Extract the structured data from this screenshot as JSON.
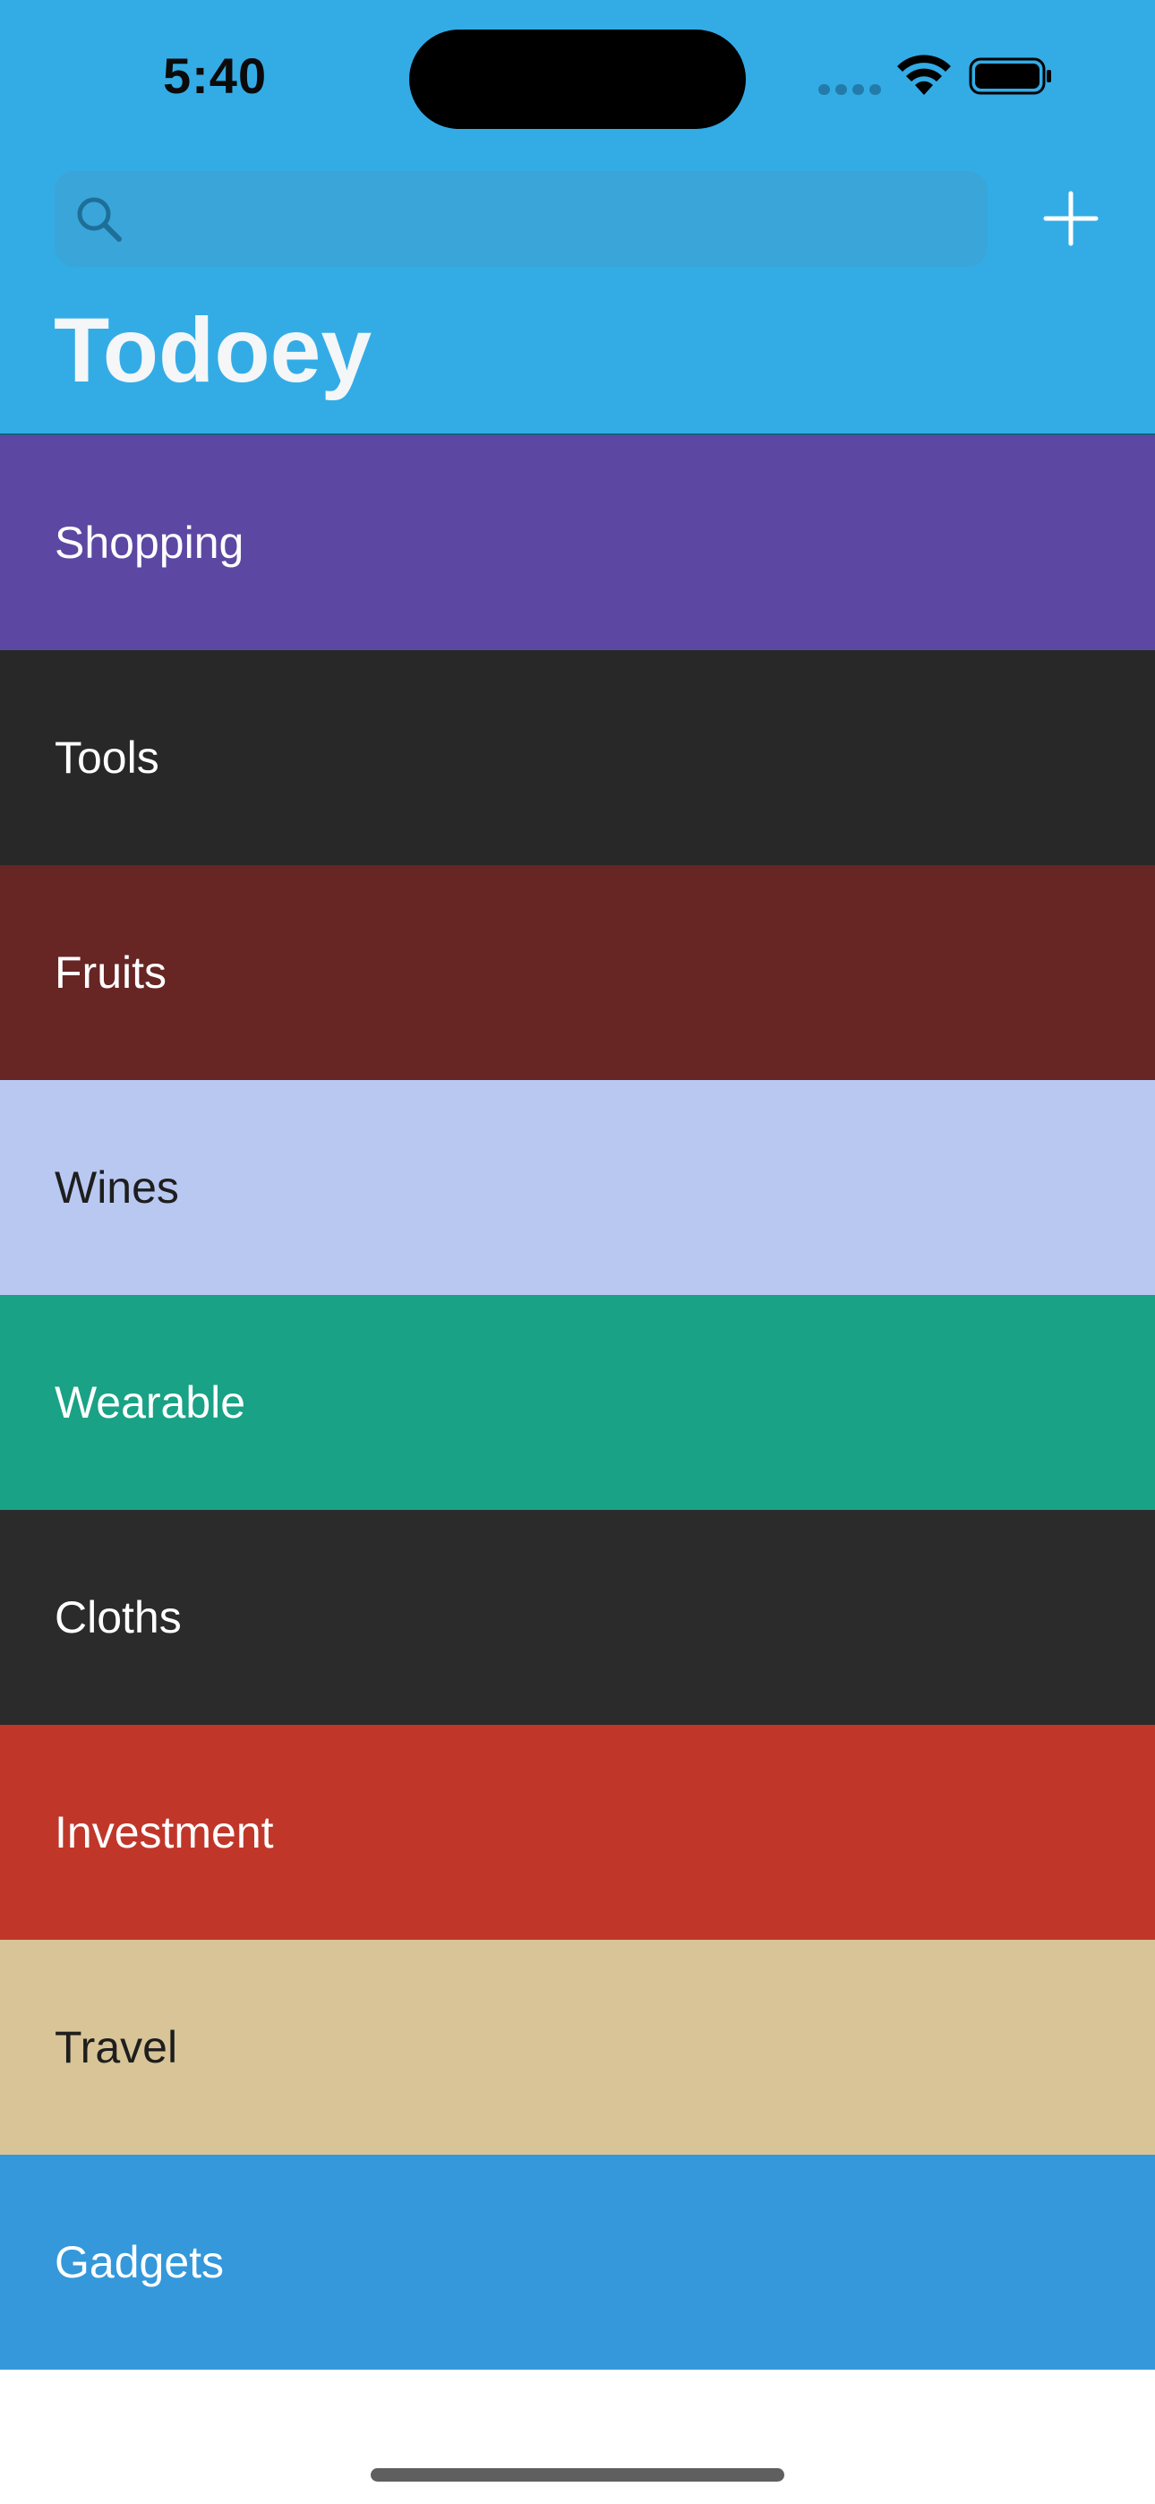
{
  "status_bar": {
    "time": "5:40",
    "icons": [
      "cell-signal-icon",
      "wifi-icon",
      "battery-icon"
    ]
  },
  "nav": {
    "search_placeholder": "",
    "search_icon": "search-icon",
    "add_icon": "plus-icon",
    "title": "Todoey"
  },
  "theme": {
    "header_color": "#33ACE6"
  },
  "categories": [
    {
      "label": "Shopping",
      "color": "#5C48A3",
      "text_color": "#FFFFFF"
    },
    {
      "label": "Tools",
      "color": "#282828",
      "text_color": "#FFFFFF"
    },
    {
      "label": "Fruits",
      "color": "#672524",
      "text_color": "#FFFFFF"
    },
    {
      "label": "Wines",
      "color": "#B8C8F1",
      "text_color": "#1E1E1E"
    },
    {
      "label": "Wearable",
      "color": "#19A285",
      "text_color": "#FFFFFF"
    },
    {
      "label": "Cloths",
      "color": "#2B2B2B",
      "text_color": "#FFFFFF"
    },
    {
      "label": "Investment",
      "color": "#C0372A",
      "text_color": "#FFFFFF"
    },
    {
      "label": "Travel",
      "color": "#D8C497",
      "text_color": "#1E1E1E"
    },
    {
      "label": "Gadgets",
      "color": "#3498DB",
      "text_color": "#FFFFFF"
    }
  ]
}
